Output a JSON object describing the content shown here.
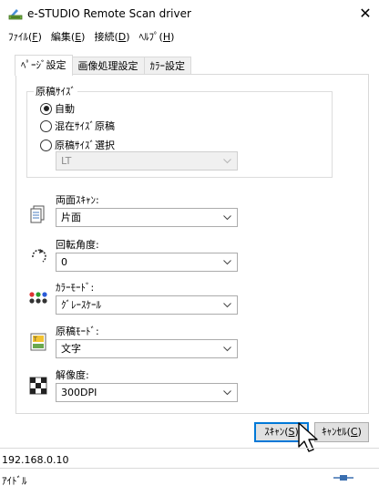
{
  "window": {
    "title": "e-STUDIO Remote Scan driver",
    "close": "✕"
  },
  "menu": [
    {
      "label": "ﾌｧｲﾙ(",
      "key": "F",
      "end": ")"
    },
    {
      "label": "編集(",
      "key": "E",
      "end": ")"
    },
    {
      "label": "接続(",
      "key": "D",
      "end": ")"
    },
    {
      "label": "ﾍﾙﾌﾟ(",
      "key": "H",
      "end": ")"
    }
  ],
  "tabs": [
    "ﾍﾟｰｼﾞ設定",
    "画像処理設定",
    "ｶﾗｰ設定"
  ],
  "original_size": {
    "legend": "原稿ｻｲｽﾞ",
    "options": [
      "自動",
      "混在ｻｲｽﾞ原稿",
      "原稿ｻｲｽﾞ選択"
    ],
    "selected": "自動",
    "size_value": "LT"
  },
  "fields": {
    "duplex": {
      "label": "両面ｽｷｬﾝ:",
      "value": "片面"
    },
    "rotation": {
      "label": "回転角度:",
      "value": "0"
    },
    "color_mode": {
      "label": "ｶﾗｰﾓｰﾄﾞ:",
      "value": "ｸﾞﾚｰｽｹｰﾙ"
    },
    "original_mode": {
      "label": "原稿ﾓｰﾄﾞ:",
      "value": "文字"
    },
    "resolution": {
      "label": "解像度:",
      "value": "300DPI"
    }
  },
  "buttons": {
    "scan": {
      "label": "ｽｷｬﾝ(",
      "key": "S",
      "end": ")"
    },
    "cancel": {
      "label": "ｷｬﾝｾﾙ(",
      "key": "C",
      "end": ")"
    }
  },
  "status": {
    "ip": "192.168.0.10",
    "state": "ｱｲﾄﾞﾙ"
  },
  "colors": {
    "default_button_border": "#0078d7",
    "disabled_text": "#8d8d8d"
  }
}
